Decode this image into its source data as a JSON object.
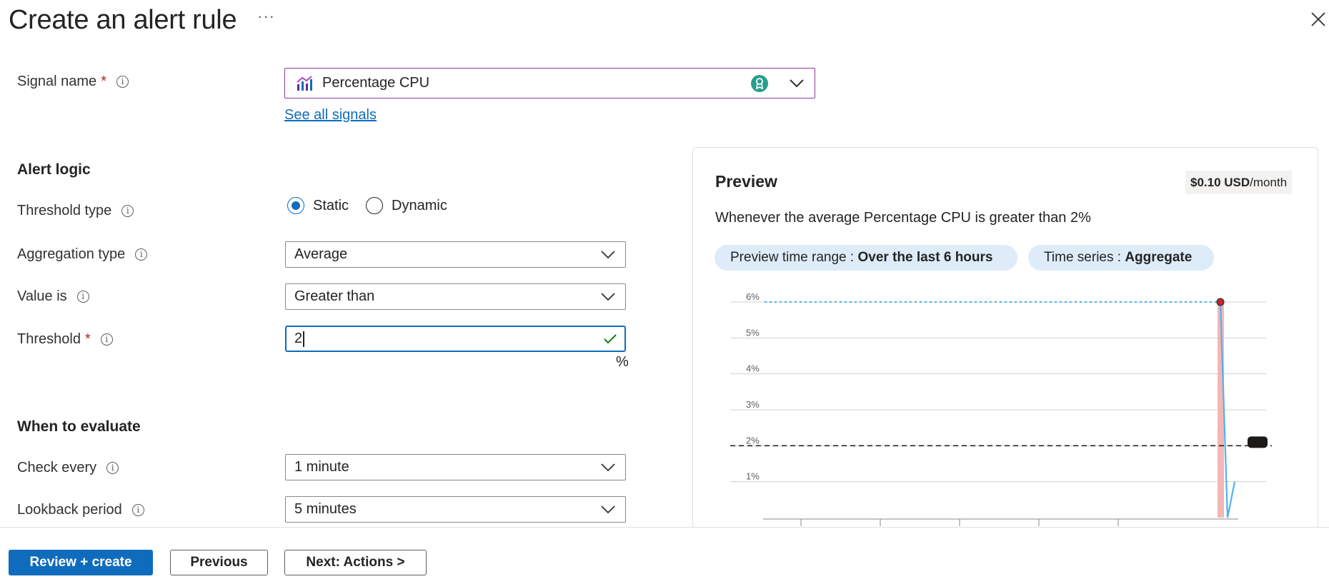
{
  "header": {
    "title": "Create an alert rule",
    "more": "···"
  },
  "signal": {
    "label": "Signal name",
    "required": "*",
    "value": "Percentage CPU",
    "see_all": "See all signals"
  },
  "alert_logic": {
    "heading": "Alert logic",
    "threshold_type": {
      "label": "Threshold type",
      "options": [
        "Static",
        "Dynamic"
      ],
      "selected": "Static"
    },
    "aggregation": {
      "label": "Aggregation type",
      "value": "Average"
    },
    "value_is": {
      "label": "Value is",
      "value": "Greater than"
    },
    "threshold": {
      "label": "Threshold",
      "required": "*",
      "value": "2",
      "unit": "%"
    }
  },
  "evaluate": {
    "heading": "When to evaluate",
    "check_every": {
      "label": "Check every",
      "value": "1 minute"
    },
    "lookback": {
      "label": "Lookback period",
      "value": "5 minutes"
    }
  },
  "preview": {
    "title": "Preview",
    "cost_amount": "$0.10 USD",
    "cost_unit": "/month",
    "description": "Whenever the average Percentage CPU is greater than 2%",
    "time_range_label": "Preview time range : ",
    "time_range_value": "Over the last 6 hours",
    "time_series_label": "Time series : ",
    "time_series_value": "Aggregate"
  },
  "chart_data": {
    "type": "line",
    "y_ticks": [
      "6%",
      "5%",
      "4%",
      "3%",
      "2%",
      "1%"
    ],
    "ylim": [
      0,
      6
    ],
    "threshold": 2,
    "series": [
      {
        "values": [
          6,
          6,
          6,
          6,
          6,
          6,
          6,
          6,
          0,
          1
        ]
      }
    ],
    "colors": {
      "line": "#4fb3f0",
      "threshold": "#242424",
      "highlight": "#f4b6b6",
      "marker": "#c4262e"
    }
  },
  "footer": {
    "review": "Review + create",
    "previous": "Previous",
    "next": "Next: Actions >"
  },
  "colors": {
    "accent": "#0f6cbd",
    "signal_border": "#8a3aa3",
    "valid": "#107c10"
  }
}
